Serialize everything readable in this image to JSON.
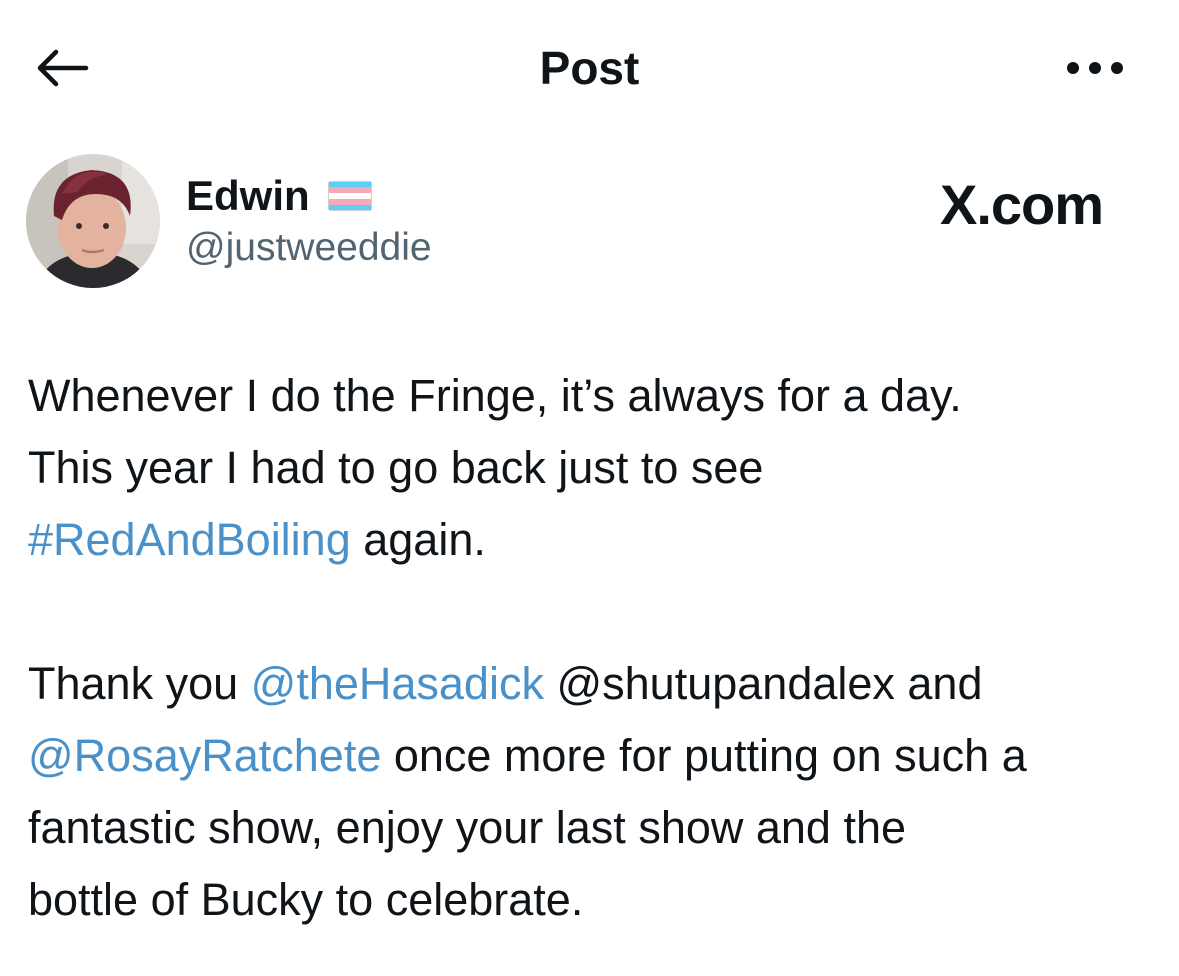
{
  "header": {
    "title": "Post",
    "back_icon": "arrow-left-icon",
    "more_icon": "more-horizontal-icon"
  },
  "author": {
    "display_name": "Edwin",
    "flag_icon": "transgender-flag-icon",
    "handle": "@justweeddie"
  },
  "watermark": "X.com",
  "tweet": {
    "paragraph1": {
      "line1": "Whenever I do the Fringe, it’s always for a day.",
      "line2": "This year I had to go back just to see",
      "hashtag": "#RedAndBoiling",
      "line3_rest": " again."
    },
    "paragraph2": {
      "intro": "Thank you ",
      "mention1": "@theHasadick",
      "mention2_text": " @shutupandalex and",
      "mention3": "@RosayRatchete",
      "line2_rest": " once more for putting on such a",
      "line3": "fantastic show, enjoy your last show and the",
      "line4": "bottle of Bucky to celebrate."
    }
  },
  "colors": {
    "link": "#4a91c9",
    "text": "#0f1419",
    "muted": "#536471",
    "flag_blue": "#5BCEFA",
    "flag_pink": "#F5A9B8",
    "flag_white": "#FFFFFF"
  }
}
